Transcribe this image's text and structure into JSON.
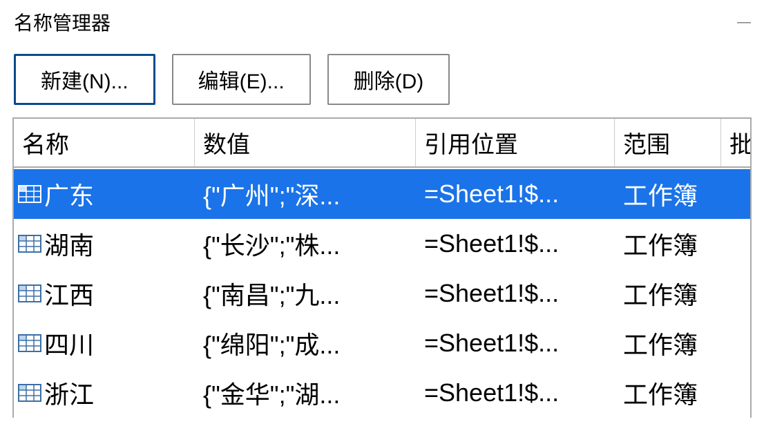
{
  "title": "名称管理器",
  "toolbar": {
    "new_label": "新建(N)...",
    "edit_label": "编辑(E)...",
    "delete_label": "删除(D)"
  },
  "columns": {
    "name": "名称",
    "value": "数值",
    "ref": "引用位置",
    "scope": "范围",
    "last": "批"
  },
  "rows": [
    {
      "name": "广东",
      "value": "{\"广州\";\"深...",
      "ref": "=Sheet1!$...",
      "scope": "工作簿",
      "selected": true
    },
    {
      "name": "湖南",
      "value": "{\"长沙\";\"株...",
      "ref": "=Sheet1!$...",
      "scope": "工作簿",
      "selected": false
    },
    {
      "name": "江西",
      "value": "{\"南昌\";\"九...",
      "ref": "=Sheet1!$...",
      "scope": "工作簿",
      "selected": false
    },
    {
      "name": "四川",
      "value": "{\"绵阳\";\"成...",
      "ref": "=Sheet1!$...",
      "scope": "工作簿",
      "selected": false
    },
    {
      "name": "浙江",
      "value": "{\"金华\";\"湖...",
      "ref": "=Sheet1!$...",
      "scope": "工作簿",
      "selected": false
    }
  ]
}
